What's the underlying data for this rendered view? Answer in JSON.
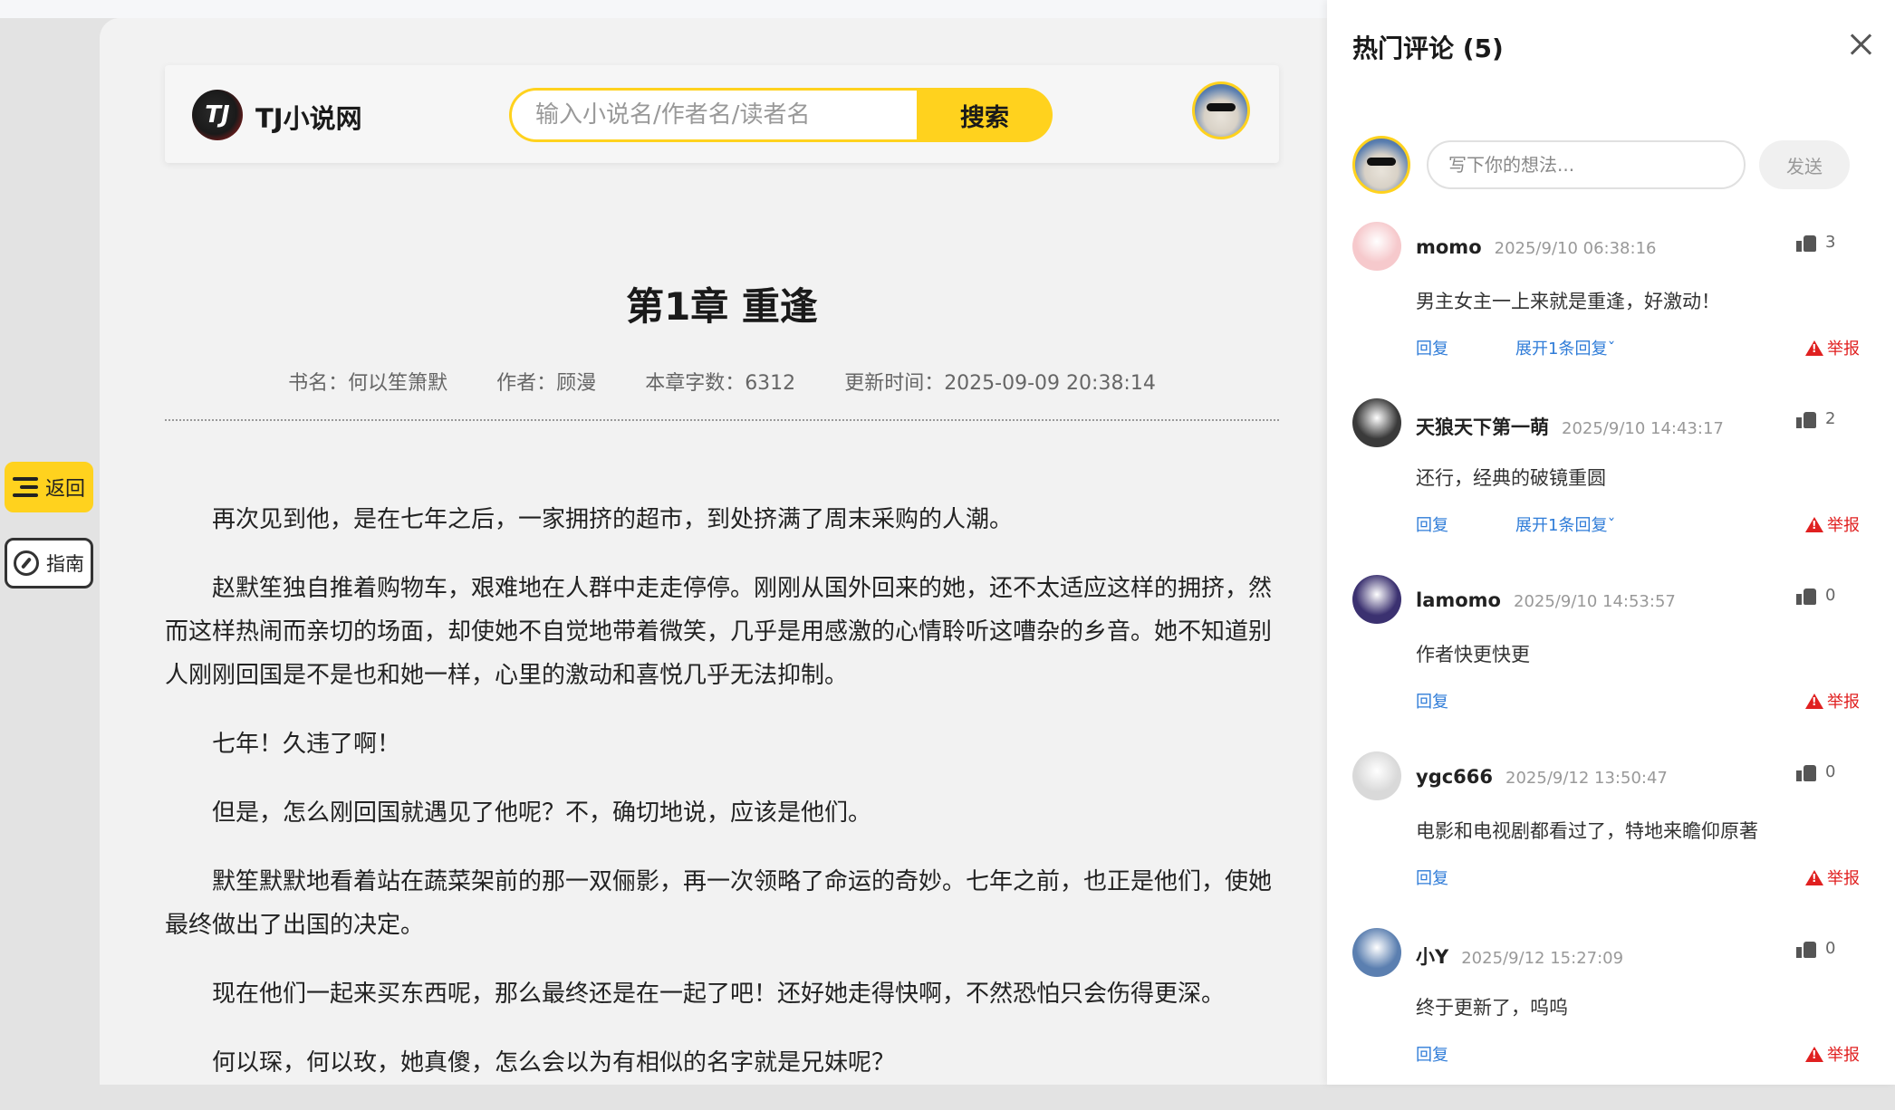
{
  "site": {
    "logo_text": "TJ",
    "name": "TJ小说网"
  },
  "search": {
    "placeholder": "输入小说名/作者名/读者名",
    "button_label": "搜索"
  },
  "side_buttons": {
    "back_label": "返回",
    "guide_label": "指南"
  },
  "chapter": {
    "title": "第1章 重逢",
    "book": "书名：何以笙箫默",
    "author": "作者：顾漫",
    "word_count": "本章字数：6312",
    "updated": "更新时间：2025-09-09 20:38:14",
    "paragraphs": [
      "再次见到他，是在七年之后，一家拥挤的超市，到处挤满了周末采购的人潮。",
      "赵默笙独自推着购物车，艰难地在人群中走走停停。刚刚从国外回来的她，还不太适应这样的拥挤，然而这样热闹而亲切的场面，却使她不自觉地带着微笑，几乎是用感激的心情聆听这嘈杂的乡音。她不知道别人刚刚回国是不是也和她一样，心里的激动和喜悦几乎无法抑制。",
      "七年！久违了啊！",
      "但是，怎么刚回国就遇见了他呢？不，确切地说，应该是他们。",
      "默笙默默地看着站在蔬菜架前的那一双俪影，再一次领略了命运的奇妙。七年之前，也正是他们，使她最终做出了出国的决定。",
      "现在他们一起来买东西呢，那么最终还是在一起了吧！还好她走得快啊，不然恐怕只会伤得更深。",
      "何以琛，何以玫，她真傻，怎么会以为有相似的名字就是兄妹呢？"
    ]
  },
  "comments_panel": {
    "title": "热门评论 (5)",
    "input_placeholder": "写下你的想法...",
    "send_label": "发送",
    "reply_label": "回复",
    "report_label": "举报",
    "comments": [
      {
        "user": "momo",
        "time": "2025/9/10 06:38:16",
        "likes": "3",
        "text": "男主女主一上来就是重逢，好激动！",
        "expand": "展开1条回复ˇ",
        "avatar_color": "#f6c9cc"
      },
      {
        "user": "天狼天下第一萌",
        "time": "2025/9/10 14:43:17",
        "likes": "2",
        "text": "还行，经典的破镜重圆",
        "expand": "展开1条回复ˇ",
        "avatar_color": "#3a3a3a"
      },
      {
        "user": "lamomo",
        "time": "2025/9/10 14:53:57",
        "likes": "0",
        "text": "作者快更快更",
        "expand": "",
        "avatar_color": "#3b3170"
      },
      {
        "user": "ygc666",
        "time": "2025/9/12 13:50:47",
        "likes": "0",
        "text": "电影和电视剧都看过了，特地来瞻仰原著",
        "expand": "",
        "avatar_color": "#d9d9d9"
      },
      {
        "user": "小Y",
        "time": "2025/9/12 15:27:09",
        "likes": "0",
        "text": "终于更新了，呜呜",
        "expand": "",
        "avatar_color": "#5b7fb0"
      }
    ]
  }
}
